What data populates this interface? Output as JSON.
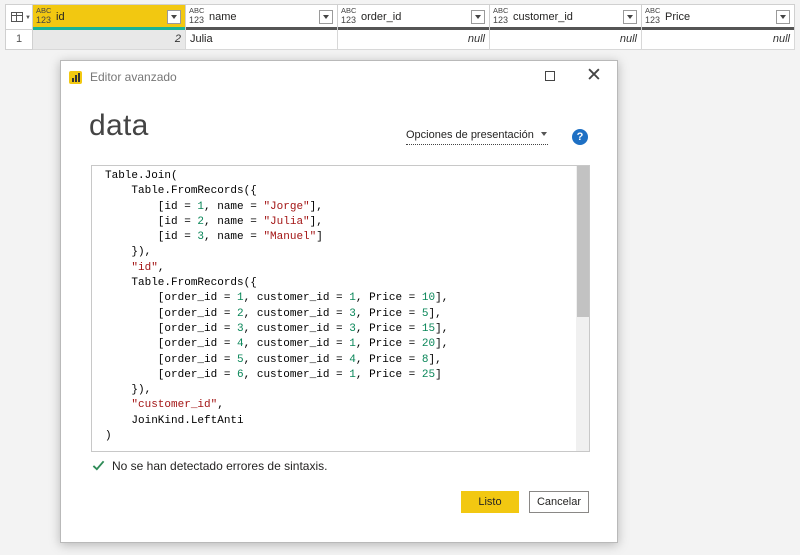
{
  "grid": {
    "columns": [
      {
        "type_top": "ABC",
        "type_bottom": "123",
        "name": "id"
      },
      {
        "type_top": "ABC",
        "type_bottom": "123",
        "name": "name"
      },
      {
        "type_top": "ABC",
        "type_bottom": "123",
        "name": "order_id"
      },
      {
        "type_top": "ABC",
        "type_bottom": "123",
        "name": "customer_id"
      },
      {
        "type_top": "ABC",
        "type_bottom": "123",
        "name": "Price"
      }
    ],
    "rows": [
      {
        "num": "1",
        "cells": [
          "2",
          "Julia",
          "null",
          "null",
          "null"
        ]
      }
    ]
  },
  "dialog": {
    "title": "Editor avanzado",
    "heading": "data",
    "presentation_label": "Opciones de presentación",
    "help_label": "?",
    "status_text": "No se han detectado errores de sintaxis.",
    "ok_label": "Listo",
    "cancel_label": "Cancelar",
    "code_lines": [
      "Table.Join(",
      "    Table.FromRecords({",
      "        [id = 1, name = \"Jorge\"],",
      "        [id = 2, name = \"Julia\"],",
      "        [id = 3, name = \"Manuel\"]",
      "    }),",
      "    \"id\",",
      "    Table.FromRecords({",
      "        [order_id = 1, customer_id = 1, Price = 10],",
      "        [order_id = 2, customer_id = 3, Price = 5],",
      "        [order_id = 3, customer_id = 3, Price = 15],",
      "        [order_id = 4, customer_id = 1, Price = 20],",
      "        [order_id = 5, customer_id = 4, Price = 8],",
      "        [order_id = 6, customer_id = 1, Price = 25]",
      "    }),",
      "    \"customer_id\",",
      "    JoinKind.LeftAnti",
      ")"
    ]
  },
  "colors": {
    "accent": "#f2c811",
    "selected_column_bar": "#1ab394",
    "help": "#1e70c4",
    "check": "#2e8b57",
    "string": "#a31515",
    "number": "#098658"
  }
}
